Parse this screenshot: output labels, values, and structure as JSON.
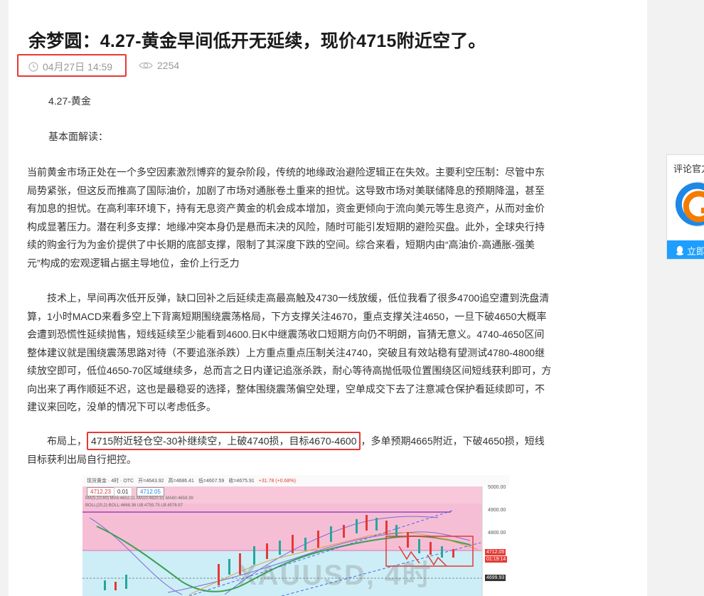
{
  "article": {
    "title": "余梦圆：4.27-黄金早间低开无延续，现价4715附近空了。",
    "date": "04月27日 14:59",
    "views": "2254",
    "paragraphs": {
      "p1": "4.27-黄金",
      "p2": "基本面解读：",
      "p3": "当前黄金市场正处在一个多空因素激烈博弈的复杂阶段，传统的地缘政治避险逻辑正在失效。主要利空压制：尽管中东局势紧张，但这反而推高了国际油价，加剧了市场对通胀卷土重来的担忧。这导致市场对美联储降息的预期降温，甚至有加息的担忧。在高利率环境下，持有无息资产黄金的机会成本增加，资金更倾向于流向美元等生息资产，从而对金价构成显著压力。潜在利多支撑：地缘冲突本身仍是悬而未决的风险，随时可能引发短期的避险买盘。此外，全球央行持续的购金行为为金价提供了中长期的底部支撑，限制了其深度下跌的空间。综合来看，短期内由“高油价-高通胀-强美元”构成的宏观逻辑占据主导地位，金价上行乏力",
      "p4": "技术上，早间再次低开反弹，缺口回补之后延续走高最高触及4730一线放缓，低位我看了很多4700追空遭到洗盘清算，1小时MACD来看多空上下背离短期围绕震荡格局，下方支撑关注4670，重点支撑关注4650，一旦下破4650大概率会遭到恐慌性延续抛售，短线延续至少能看到4600.日K中继震荡收口短期方向仍不明朗，盲猜无意义。4740-4650区间整体建议就是围绕震荡思路对待（不要追涨杀跌）上方重点重点压制关注4740，突破且有效站稳有望测试4780-4800继续放空即可，低位4650-70区域继续多，总而言之日内谨记追涨杀跌，耐心等待高抛低吸位置围绕区间短线获利即可，方向出来了再作顺延不迟，这也是最稳妥的选择，整体围绕震荡偏空处理，空单成交下去了注意减仓保护看延续即可，不建议来回吃，没单的情况下可以考虑低多。",
      "p5_lead": "布局上，",
      "p5_highlight": "4715附近轻仓空-30补继续空，上破4740损，目标4670-4600",
      "p5_tail": "，多单预期4665附近，下破4650损，短线目标获利出局自行把控。"
    }
  },
  "side_widget": {
    "title": "评论官方",
    "button_label": "立即"
  },
  "chart": {
    "header_items": [
      "现货黄金 · 4时 · OTC",
      "开=4643.92",
      "高=4686.41",
      "低=4607.59",
      "收=4675.91",
      "+31.78 (+0.68%)"
    ],
    "price_tag_left": "4712.23",
    "price_tag_mid": "0.01",
    "price_tag_right": "4712.05",
    "indicator_ma": "MA(5,10,60)  MA5:4652.21  MA10:4620.51  MA60:4659.39",
    "indicator_boll": "BOLL(20,2)  BOLL:4668.36  UB:4759.75  LB:4576.97",
    "axis": {
      "a5000": "5000.00",
      "a4900": "4900.00",
      "a4800": "4800.00",
      "current": "4712.05",
      "countdown": "01:19:14",
      "a4699": "4699.93"
    },
    "watermark": "XAUUSD, 4时",
    "colors": {
      "up": "#e53935",
      "down": "#26a69a",
      "pink_zone": "#f8c7da",
      "blue_zone": "#bfe9f2",
      "highlight": "#e53935"
    }
  }
}
